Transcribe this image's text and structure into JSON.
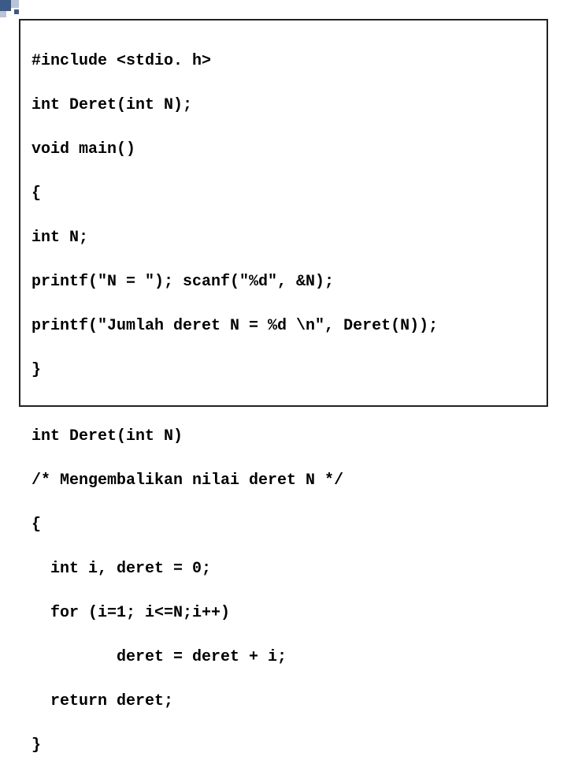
{
  "code": {
    "lines": [
      "#include <stdio. h>",
      "int Deret(int N);",
      "void main()",
      "{",
      "int N;",
      "printf(\"N = \"); scanf(\"%d\", &N);",
      "printf(\"Jumlah deret N = %d \\n\", Deret(N));",
      "}",
      "",
      "int Deret(int N)",
      "/* Mengembalikan nilai deret N */",
      "{",
      "  int i, deret = 0;",
      "  for (i=1; i<=N;i++)",
      "         deret = deret + i;",
      "  return deret;",
      "}"
    ]
  }
}
